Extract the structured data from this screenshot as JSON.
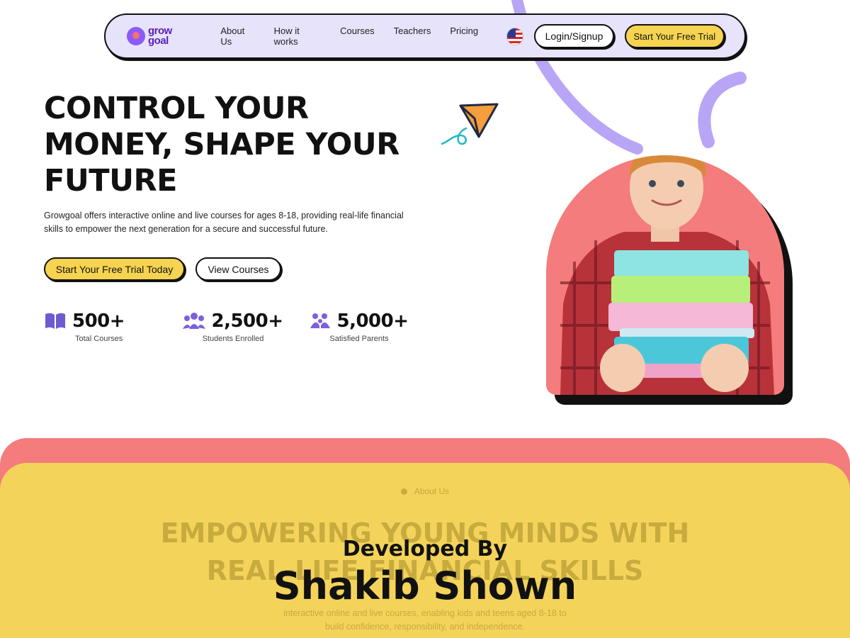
{
  "brand": {
    "logo_top": "grow",
    "logo_bottom": "goal"
  },
  "nav": {
    "links": [
      "About Us",
      "How it works",
      "Courses",
      "Teachers",
      "Pricing"
    ],
    "language_icon": "us-flag-icon",
    "login_label": "Login/Signup",
    "trial_label": "Start Your Free Trial"
  },
  "hero": {
    "title_lines": [
      "CONTROL YOUR",
      "MONEY, SHAPE YOUR",
      "FUTURE"
    ],
    "description_lines": [
      "Growgoal offers interactive online and live courses for ages 8-18, providing real-life financial",
      "skills to empower the next generation for a secure and successful future."
    ],
    "cta_trial": "Start Your Free Trial Today",
    "cta_courses": "View Courses"
  },
  "stats": [
    {
      "icon": "open-book-icon",
      "value": "500+",
      "label": "Total Courses"
    },
    {
      "icon": "group-icon",
      "value": "2,500+",
      "label": "Students Enrolled"
    },
    {
      "icon": "parents-icon",
      "value": "5,000+",
      "label": "Satisfied Parents"
    }
  ],
  "about": {
    "tag": "About Us",
    "title_lines": [
      "EMPOWERING YOUNG MINDS WITH",
      "REAL-LIFE FINANCIAL SKILLS"
    ],
    "text_lines": [
      "interactive online and live courses, enabling kids and teens aged 8-18 to",
      "build confidence, responsibility, and independence."
    ]
  },
  "watermark": {
    "line1": "Developed By",
    "line2": "Shakib Shown"
  },
  "colors": {
    "nav_bg": "#e6e3fb",
    "accent_yellow": "#f6d350",
    "accent_coral": "#f47c7c",
    "accent_purple": "#8b5cf6",
    "section_yellow": "#f3d35a"
  }
}
